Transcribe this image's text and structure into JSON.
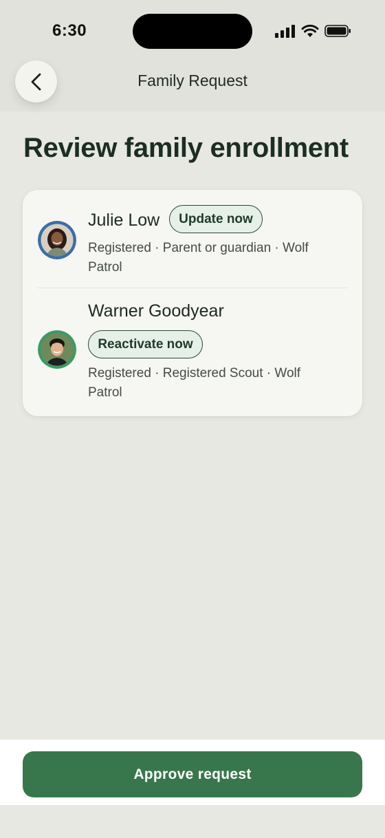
{
  "status_bar": {
    "time": "6:30",
    "icons": [
      "cellular-signal-icon",
      "wifi-icon",
      "battery-icon"
    ]
  },
  "nav": {
    "title": "Family Request",
    "back_icon": "chevron-left-icon"
  },
  "page": {
    "title": "Review family enrollment"
  },
  "members": [
    {
      "name": "Julie Low",
      "action_label": "Update now",
      "details": "Registered · Parent or guardian · Wolf Patrol",
      "avatar_ring_color": "#3a6ea8"
    },
    {
      "name": "Warner Goodyear",
      "action_label": "Reactivate now",
      "details": "Registered · Registered Scout · Wolf Patrol",
      "avatar_ring_color": "#3d9a63"
    }
  ],
  "footer": {
    "approve_label": "Approve request"
  },
  "colors": {
    "background": "#e8e8e3",
    "card": "#f6f6f2",
    "primary": "#38774b",
    "pill_border": "#2a4a36",
    "pill_fill": "#e6efe8",
    "title": "#1c2e22"
  }
}
